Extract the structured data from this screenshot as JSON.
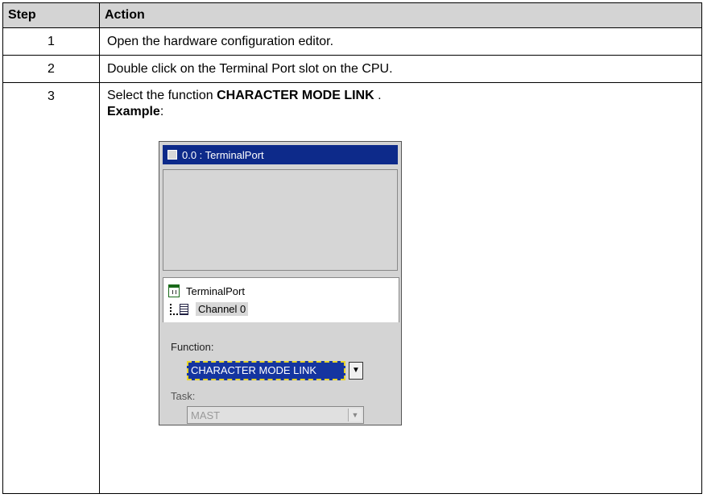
{
  "table": {
    "header": {
      "step": "Step",
      "action": "Action"
    },
    "rows": [
      {
        "step": "1",
        "action": "Open the hardware configuration editor."
      },
      {
        "step": "2",
        "action": "Double click on the Terminal Port slot on the CPU."
      },
      {
        "step": "3",
        "action_prefix": "Select the function ",
        "action_bold": "CHARACTER MODE LINK",
        "action_suffix": " .",
        "example_label": "Example",
        "example_colon": ":"
      }
    ]
  },
  "screenshot": {
    "title": "0.0 : TerminalPort",
    "tree": {
      "module": "TerminalPort",
      "channel": "Channel 0"
    },
    "function_label": "Function:",
    "function_value": "CHARACTER MODE LINK",
    "task_label": "Task:",
    "task_value": "MAST",
    "dropdown_glyph": "▼"
  }
}
